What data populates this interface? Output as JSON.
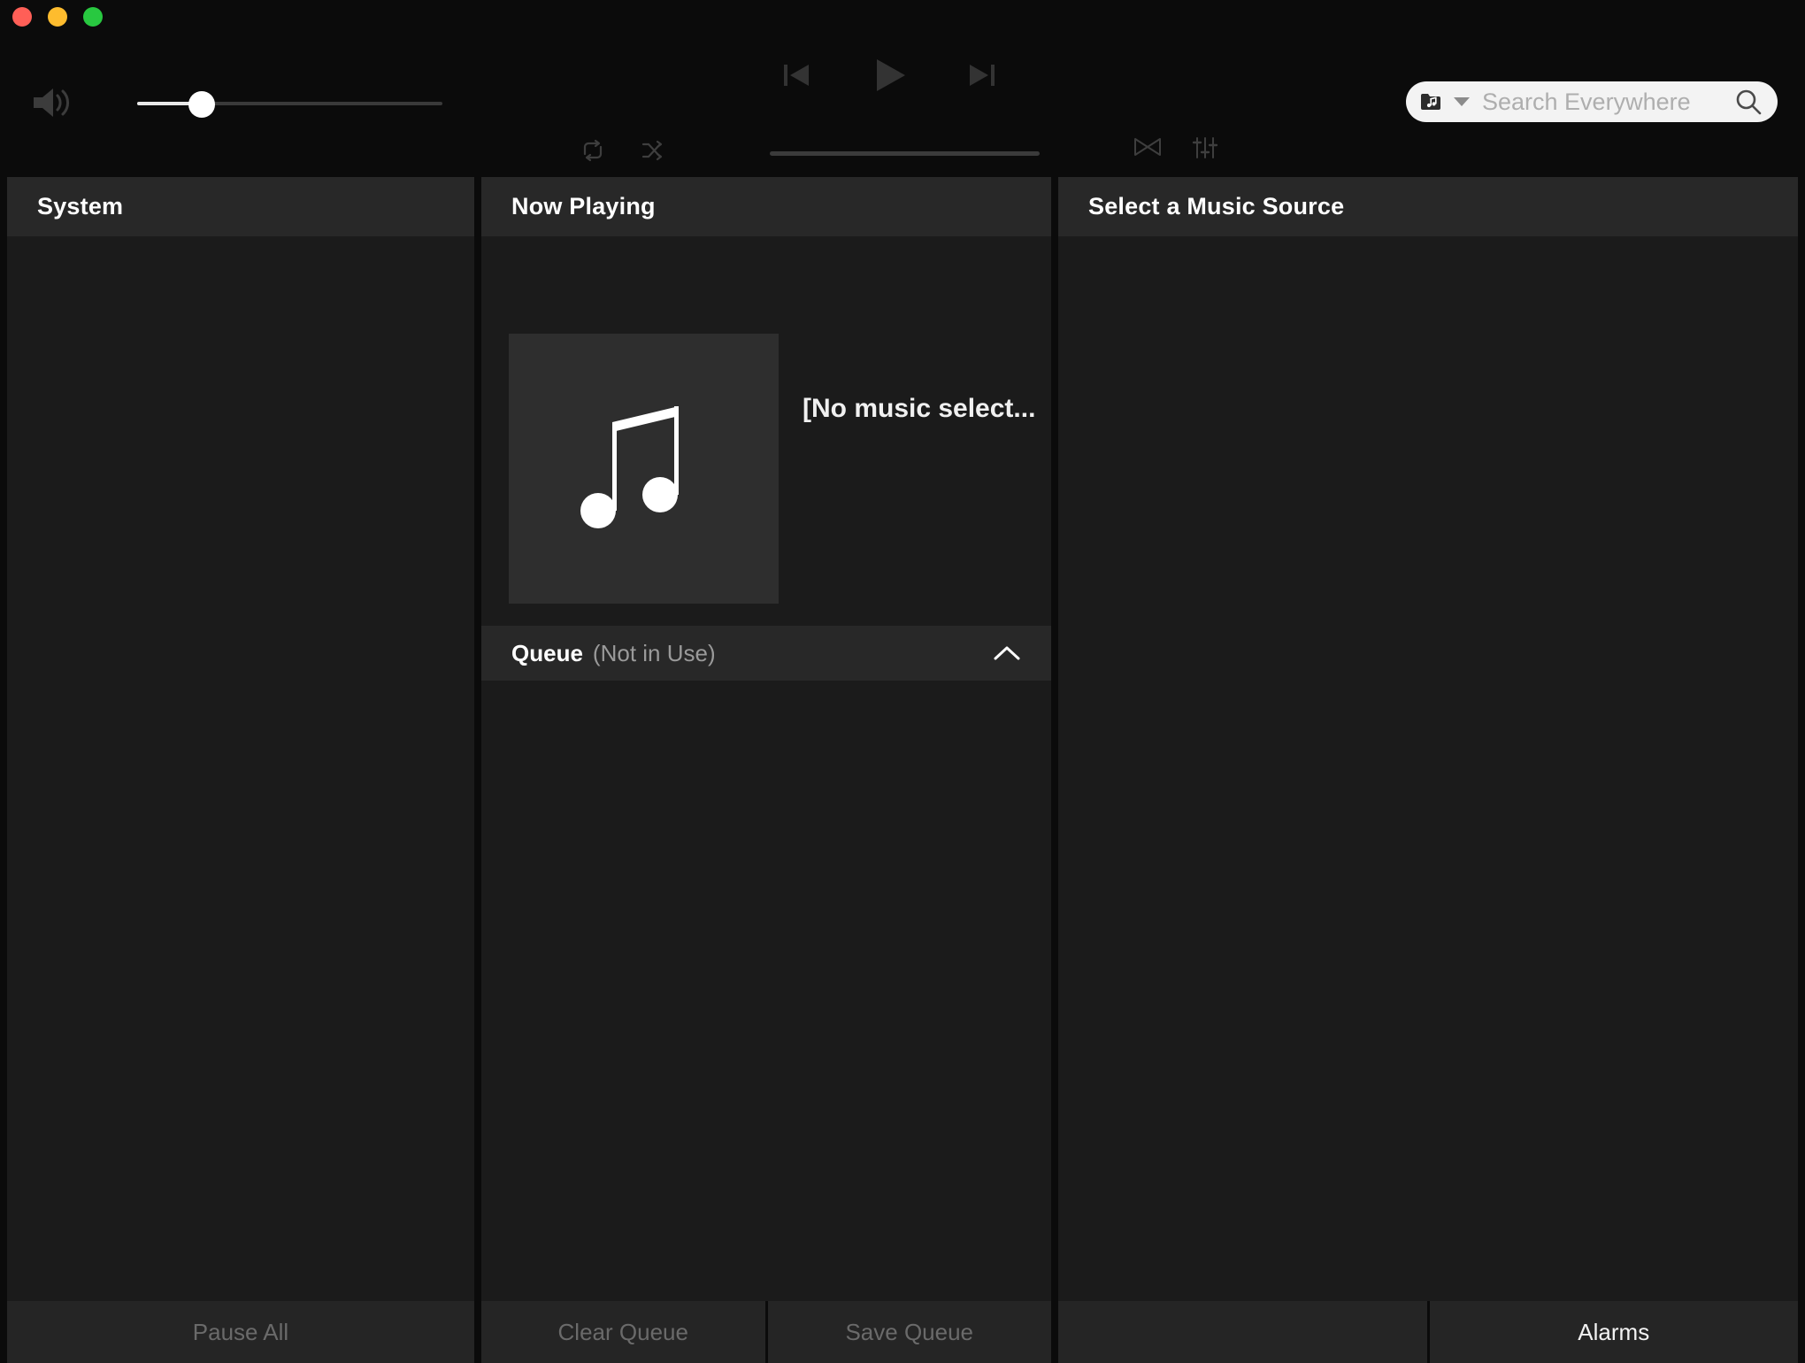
{
  "window": {
    "traffic_lights": [
      {
        "name": "close",
        "color": "#ff5f57"
      },
      {
        "name": "minimize",
        "color": "#febc2e"
      },
      {
        "name": "zoom",
        "color": "#28c840"
      }
    ]
  },
  "toolbar": {
    "volume": {
      "icon": "speaker-volume-icon",
      "value": 18,
      "min": 0,
      "max": 100
    },
    "transport": {
      "previous": "previous-track-icon",
      "play": "play-icon",
      "next": "next-track-icon"
    },
    "secondary": {
      "repeat": "repeat-icon",
      "shuffle": "shuffle-icon",
      "crossfade": "crossfade-icon",
      "equalizer": "equalizer-icon"
    },
    "progress": {
      "value": 0,
      "min": 0,
      "max": 100
    }
  },
  "search": {
    "scope_icon": "music-folder-icon",
    "dropdown_icon": "chevron-down-icon",
    "value": "",
    "placeholder": "Search Everywhere",
    "submit_icon": "search-icon"
  },
  "panels": {
    "system": {
      "title": "System",
      "items": []
    },
    "now_playing": {
      "title": "Now Playing",
      "album_art_icon": "music-note-icon",
      "track_title": "[No music select...",
      "queue": {
        "label": "Queue",
        "status": "(Not in Use)",
        "collapse_icon": "chevron-up-icon",
        "items": []
      }
    },
    "music_source": {
      "title": "Select a Music Source",
      "items": []
    }
  },
  "bottom_bar": {
    "system_buttons": [
      {
        "label": "Pause All",
        "enabled": false
      }
    ],
    "queue_buttons": [
      {
        "label": "Clear Queue",
        "enabled": false
      },
      {
        "label": "Save Queue",
        "enabled": false
      }
    ],
    "source_buttons": [
      {
        "label": "",
        "enabled": false
      },
      {
        "label": "Alarms",
        "enabled": true
      }
    ]
  }
}
